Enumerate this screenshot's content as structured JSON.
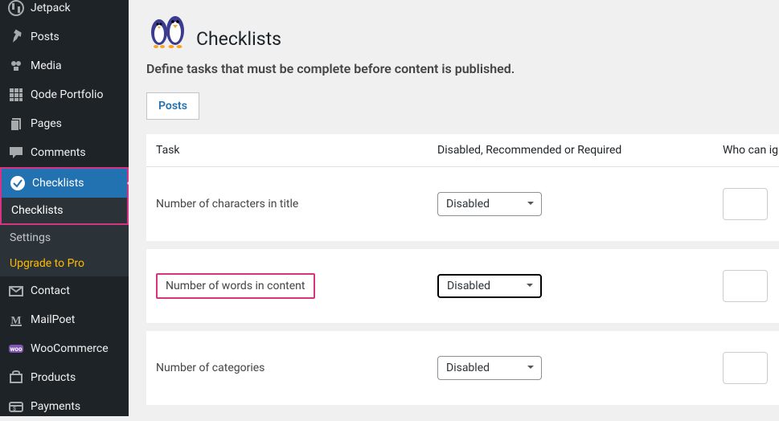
{
  "sidebar": {
    "items": [
      {
        "label": "Jetpack",
        "icon": "jetpack"
      },
      {
        "label": "Posts",
        "icon": "pin"
      },
      {
        "label": "Media",
        "icon": "media"
      },
      {
        "label": "Qode Portfolio",
        "icon": "grid"
      },
      {
        "label": "Pages",
        "icon": "page"
      },
      {
        "label": "Comments",
        "icon": "comment"
      },
      {
        "label": "Checklists",
        "icon": "check",
        "active": true
      },
      {
        "label": "Contact",
        "icon": "mail"
      },
      {
        "label": "MailPoet",
        "icon": "mailpoet"
      },
      {
        "label": "WooCommerce",
        "icon": "woo"
      },
      {
        "label": "Products",
        "icon": "products"
      },
      {
        "label": "Payments",
        "icon": "payments"
      }
    ],
    "submenu": {
      "current": "Checklists",
      "settings": "Settings",
      "upgrade": "Upgrade to Pro"
    }
  },
  "page": {
    "title": "Checklists",
    "subtitle": "Define tasks that must be complete before content is published.",
    "tab": "Posts",
    "columns": {
      "task": "Task",
      "rule": "Disabled, Recommended or Required",
      "who": "Who can ig"
    },
    "rows": [
      {
        "task": "Number of characters in title",
        "rule": "Disabled"
      },
      {
        "task": "Number of words in content",
        "rule": "Disabled",
        "highlighted": true
      },
      {
        "task": "Number of categories",
        "rule": "Disabled"
      }
    ]
  }
}
